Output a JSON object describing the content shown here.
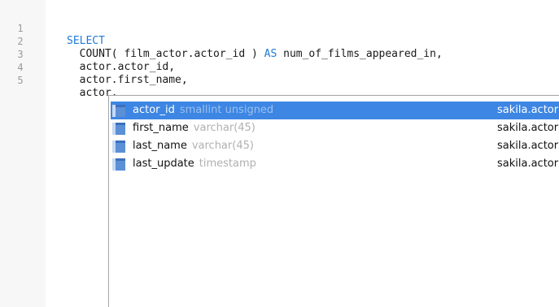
{
  "editor": {
    "lines": [
      {
        "num": "1",
        "keyword": "SELECT",
        "text": ""
      },
      {
        "num": "2",
        "pre": "  COUNT( film_actor.actor_id ) ",
        "keyword": "AS",
        "post": " num_of_films_appeared_in,"
      },
      {
        "num": "3",
        "text": "  actor.actor_id,"
      },
      {
        "num": "4",
        "text": "  actor.first_name,"
      },
      {
        "num": "5",
        "text": "  actor."
      }
    ]
  },
  "autocomplete": {
    "items": [
      {
        "name": "actor_id",
        "type": "smallint unsigned",
        "source": "sakila.actor",
        "icon": "column-icon",
        "selected": true
      },
      {
        "name": "first_name",
        "type": "varchar(45)",
        "source": "sakila.actor",
        "icon": "column-icon",
        "selected": false
      },
      {
        "name": "last_name",
        "type": "varchar(45)",
        "source": "sakila.actor",
        "icon": "column-icon",
        "selected": false
      },
      {
        "name": "last_update",
        "type": "timestamp",
        "source": "sakila.actor",
        "icon": "column-icon",
        "selected": false
      }
    ]
  },
  "colors": {
    "keyword": "#1f7ad6",
    "selection": "#3d86e3",
    "type_hint": "#b0b0b0"
  }
}
